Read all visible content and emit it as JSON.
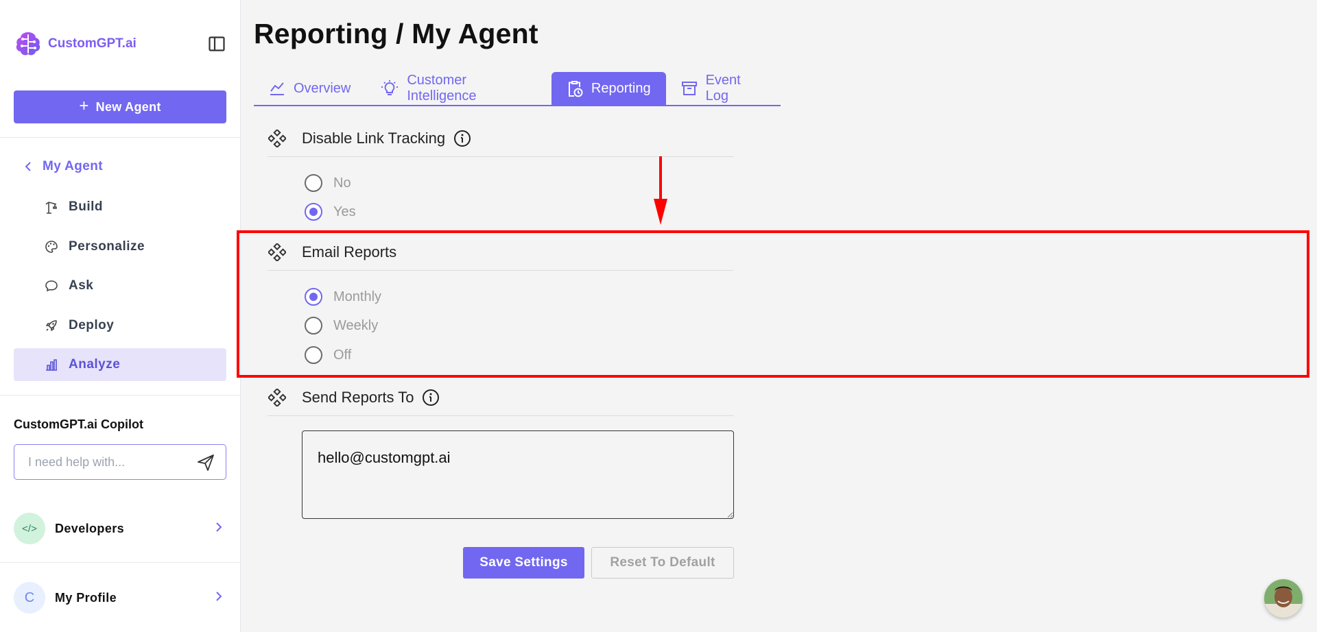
{
  "sidebar": {
    "logo_text": "CustomGPT.ai",
    "new_agent_label": "New Agent",
    "back_label": "My Agent",
    "items": [
      {
        "label": "Build",
        "icon": "crane-icon"
      },
      {
        "label": "Personalize",
        "icon": "palette-icon"
      },
      {
        "label": "Ask",
        "icon": "chat-bubble-icon"
      },
      {
        "label": "Deploy",
        "icon": "rocket-icon"
      },
      {
        "label": "Analyze",
        "icon": "bar-chart-icon",
        "active": true
      }
    ],
    "copilot": {
      "title": "CustomGPT.ai Copilot",
      "placeholder": "I need help with..."
    },
    "developers_label": "Developers",
    "profile_label": "My Profile",
    "profile_initial": "C"
  },
  "page": {
    "title": "Reporting / My Agent",
    "tabs": [
      {
        "label": "Overview",
        "icon": "line-chart-icon"
      },
      {
        "label": "Customer Intelligence",
        "icon": "lightbulb-icon"
      },
      {
        "label": "Reporting",
        "icon": "clipboard-clock-icon",
        "active": true
      },
      {
        "label": "Event Log",
        "icon": "archive-icon"
      }
    ]
  },
  "settings": {
    "link_tracking": {
      "title": "Disable Link Tracking",
      "options": [
        "No",
        "Yes"
      ],
      "selected": "Yes"
    },
    "email_reports": {
      "title": "Email Reports",
      "options": [
        "Monthly",
        "Weekly",
        "Off"
      ],
      "selected": "Monthly"
    },
    "send_reports_to": {
      "title": "Send Reports To",
      "value": "hello@customgpt.ai"
    },
    "save_label": "Save Settings",
    "reset_label": "Reset To Default"
  },
  "colors": {
    "accent": "#7267f0",
    "annotation": "#ff0000"
  }
}
